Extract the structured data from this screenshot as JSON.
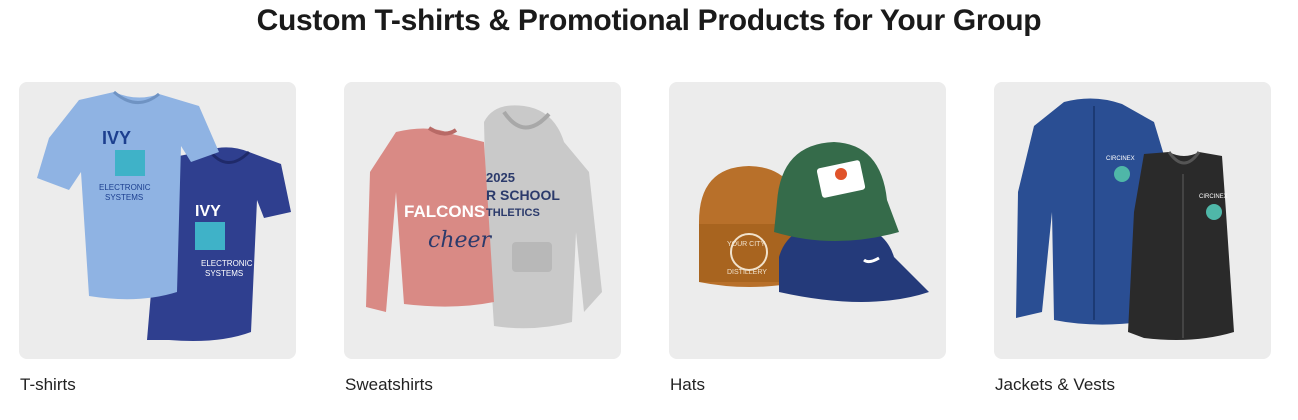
{
  "heading": "Custom T-shirts & Promotional Products for Your Group",
  "categories": [
    {
      "label": "T-shirts",
      "image": "t-shirts-photo",
      "print": {
        "brand": "IVY",
        "line1": "ELECTRONIC",
        "line2": "SYSTEMS"
      }
    },
    {
      "label": "Sweatshirts",
      "image": "sweatshirts-photo",
      "print": {
        "word": "FALCONS",
        "script": "cheer",
        "year": "2025",
        "school": "R SCHOOL",
        "athletics": "THLETICS"
      }
    },
    {
      "label": "Hats",
      "image": "hats-photo",
      "print": {
        "patch1": "YOUR CITY",
        "patch2": "DISTILLERY"
      }
    },
    {
      "label": "Jackets & Vests",
      "image": "jackets-photo",
      "print": {
        "brand": "CIRCINEX"
      }
    }
  ],
  "colors": {
    "card_bg": "#ececec",
    "tee_light": "#8fb3e3",
    "tee_dark": "#2f3f8f",
    "sweat_pink": "#d98a85",
    "sweat_gray": "#c9c9c9",
    "jacket_blue": "#2a4e93",
    "vest_black": "#2a2a2a"
  }
}
